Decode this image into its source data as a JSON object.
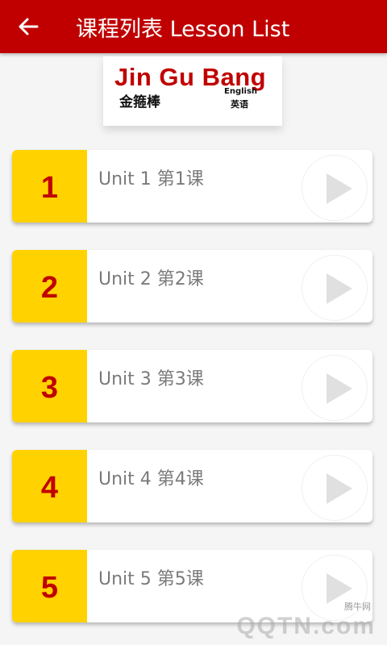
{
  "header": {
    "title": "课程列表 Lesson List",
    "back_icon": "arrow-left-icon"
  },
  "logo": {
    "main": "Jin Gu Bang",
    "cn": "金箍棒",
    "english": "English",
    "cn_english": "英语"
  },
  "lessons": [
    {
      "number": "1",
      "label": "Unit 1 第1课"
    },
    {
      "number": "2",
      "label": "Unit 2 第2课"
    },
    {
      "number": "3",
      "label": "Unit 3 第3课"
    },
    {
      "number": "4",
      "label": "Unit 4 第4课"
    },
    {
      "number": "5",
      "label": "Unit 5 第5课"
    }
  ],
  "watermark": {
    "small": "腾牛网",
    "text": "QQTN.com"
  },
  "colors": {
    "appbar": "#c00000",
    "number_bg": "#ffd200",
    "number_text": "#c00000",
    "play_icon": "#e0e0e0"
  }
}
